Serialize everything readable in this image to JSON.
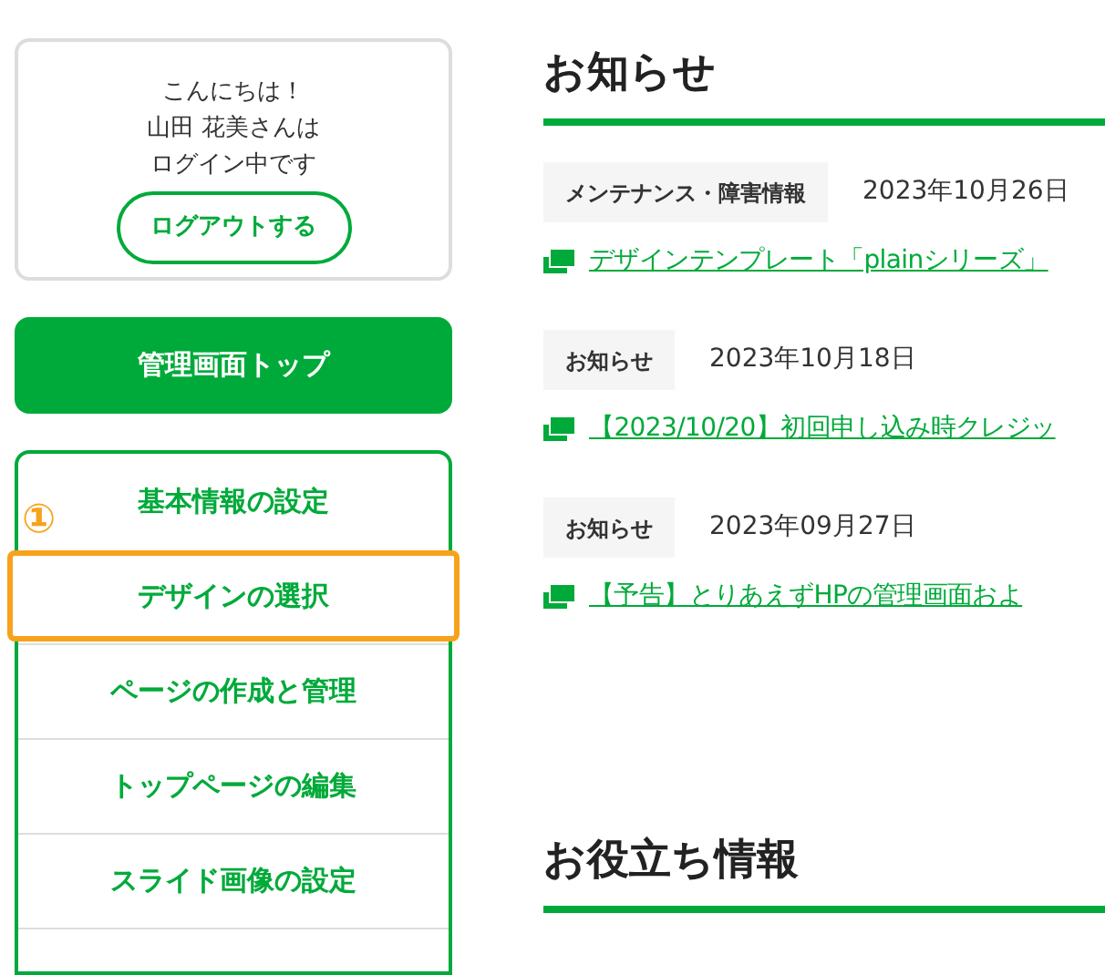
{
  "login_card": {
    "greeting": "こんにちは！",
    "user": "山田 花美さんは",
    "status": "ログイン中です",
    "logout_button": "ログアウトする"
  },
  "admin_top_button": "管理画面トップ",
  "nav": [
    {
      "label": "基本情報の設定",
      "highlighted": false
    },
    {
      "label": "デザインの選択",
      "highlighted": true,
      "marker": "①"
    },
    {
      "label": "ページの作成と管理",
      "highlighted": false
    },
    {
      "label": "トップページの編集",
      "highlighted": false
    },
    {
      "label": "スライド画像の設定",
      "highlighted": false
    }
  ],
  "news": {
    "title": "お知らせ",
    "items": [
      {
        "tag": "メンテナンス・障害情報",
        "date": "2023年10月26日",
        "link": "デザインテンプレート「plainシリーズ」"
      },
      {
        "tag": "お知らせ",
        "date": "2023年10月18日",
        "link": "【2023/10/20】初回申し込み時クレジッ"
      },
      {
        "tag": "お知らせ",
        "date": "2023年09月27日",
        "link": "【予告】とりあえずHPの管理画面およ"
      }
    ]
  },
  "tips": {
    "title": "お役立ち情報"
  }
}
